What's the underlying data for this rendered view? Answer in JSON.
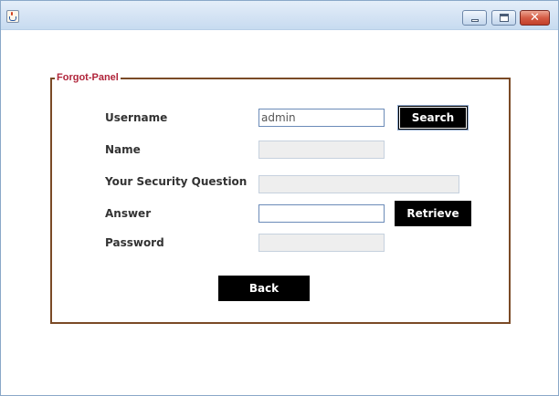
{
  "panel": {
    "title": "Forgot-Panel"
  },
  "form": {
    "username": {
      "label": "Username",
      "value": "admin",
      "placeholder": ""
    },
    "name": {
      "label": "Name",
      "value": "",
      "placeholder": ""
    },
    "question": {
      "label": "Your Security Question",
      "value": "",
      "placeholder": ""
    },
    "answer": {
      "label": "Answer",
      "value": "",
      "placeholder": ""
    },
    "password": {
      "label": "Password",
      "value": "",
      "placeholder": ""
    }
  },
  "buttons": {
    "search": "Search",
    "retrieve": "Retrieve",
    "back": "Back"
  },
  "window": {
    "close_glyph": "✕"
  },
  "icons": {
    "app": "java-cup-icon",
    "minimize": "minimize-icon",
    "maximize": "maximize-icon",
    "close": "close-icon"
  }
}
